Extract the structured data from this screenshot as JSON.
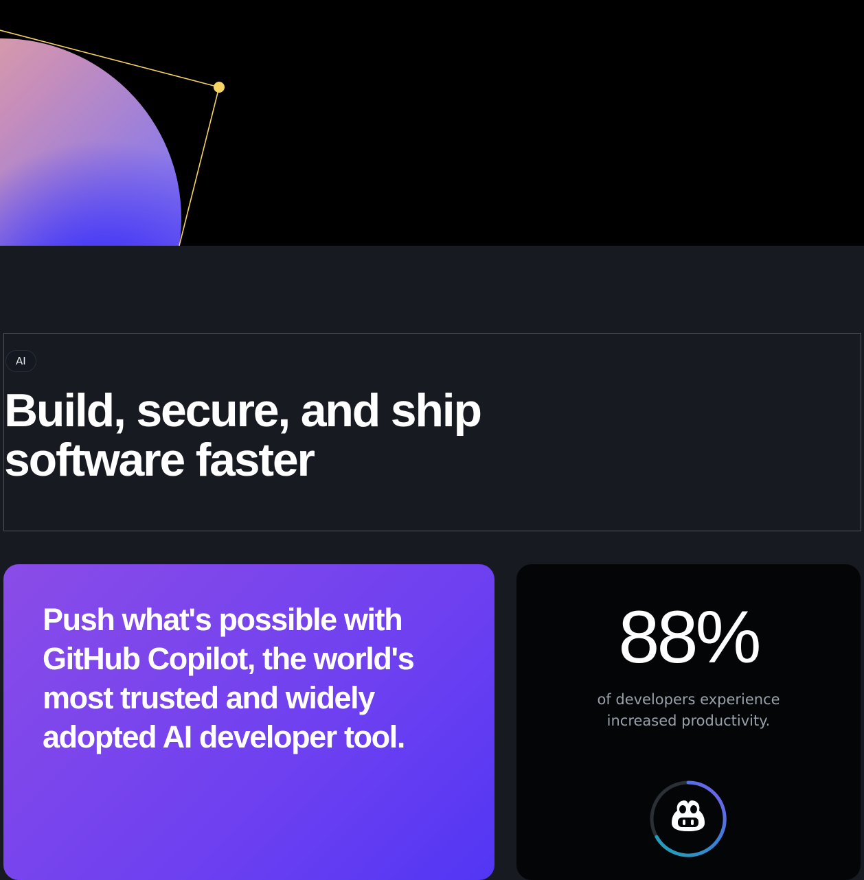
{
  "section": {
    "tag": "AI",
    "headline_line1": "Build, secure, and ship",
    "headline_line2": "software faster"
  },
  "feature_card": {
    "text": "Push what's possible with GitHub Copilot, the world's most trusted and widely adopted AI developer tool."
  },
  "stat_card": {
    "value": "88%",
    "caption": "of developers experience increased productivity.",
    "icon": "copilot-icon"
  },
  "colors": {
    "page_background": "#171b21",
    "hero_background": "#000000",
    "accent_yellow": "#f6d463",
    "purple_card_start": "#8a4ce8",
    "purple_card_end": "#5236f4",
    "stat_card_background": "#030507",
    "highlight_frame": "#d61e1e"
  }
}
